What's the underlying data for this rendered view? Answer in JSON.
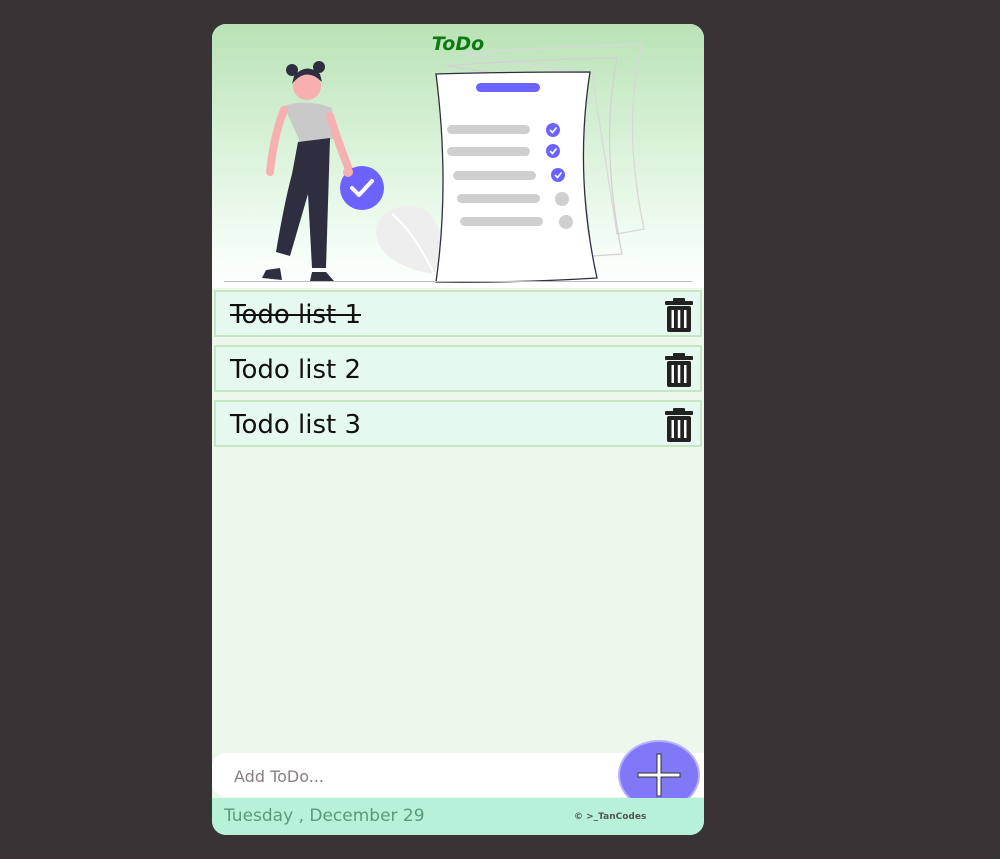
{
  "app": {
    "title": "ToDo"
  },
  "todos": [
    {
      "text": "Todo list 1",
      "completed": true
    },
    {
      "text": "Todo list 2",
      "completed": false
    },
    {
      "text": "Todo list 3",
      "completed": false
    }
  ],
  "input": {
    "placeholder": "Add ToDo..."
  },
  "footer": {
    "date": "Tuesday , December 29",
    "credit": "© >_TanCodes"
  },
  "icons": {
    "delete": "trash-icon",
    "add": "plus-icon",
    "check": "check-icon"
  },
  "colors": {
    "accent": "#6c63ff",
    "title": "#0f7a12",
    "item_bg": "#e6f9f1",
    "footer_bg": "#b6f1d8"
  }
}
